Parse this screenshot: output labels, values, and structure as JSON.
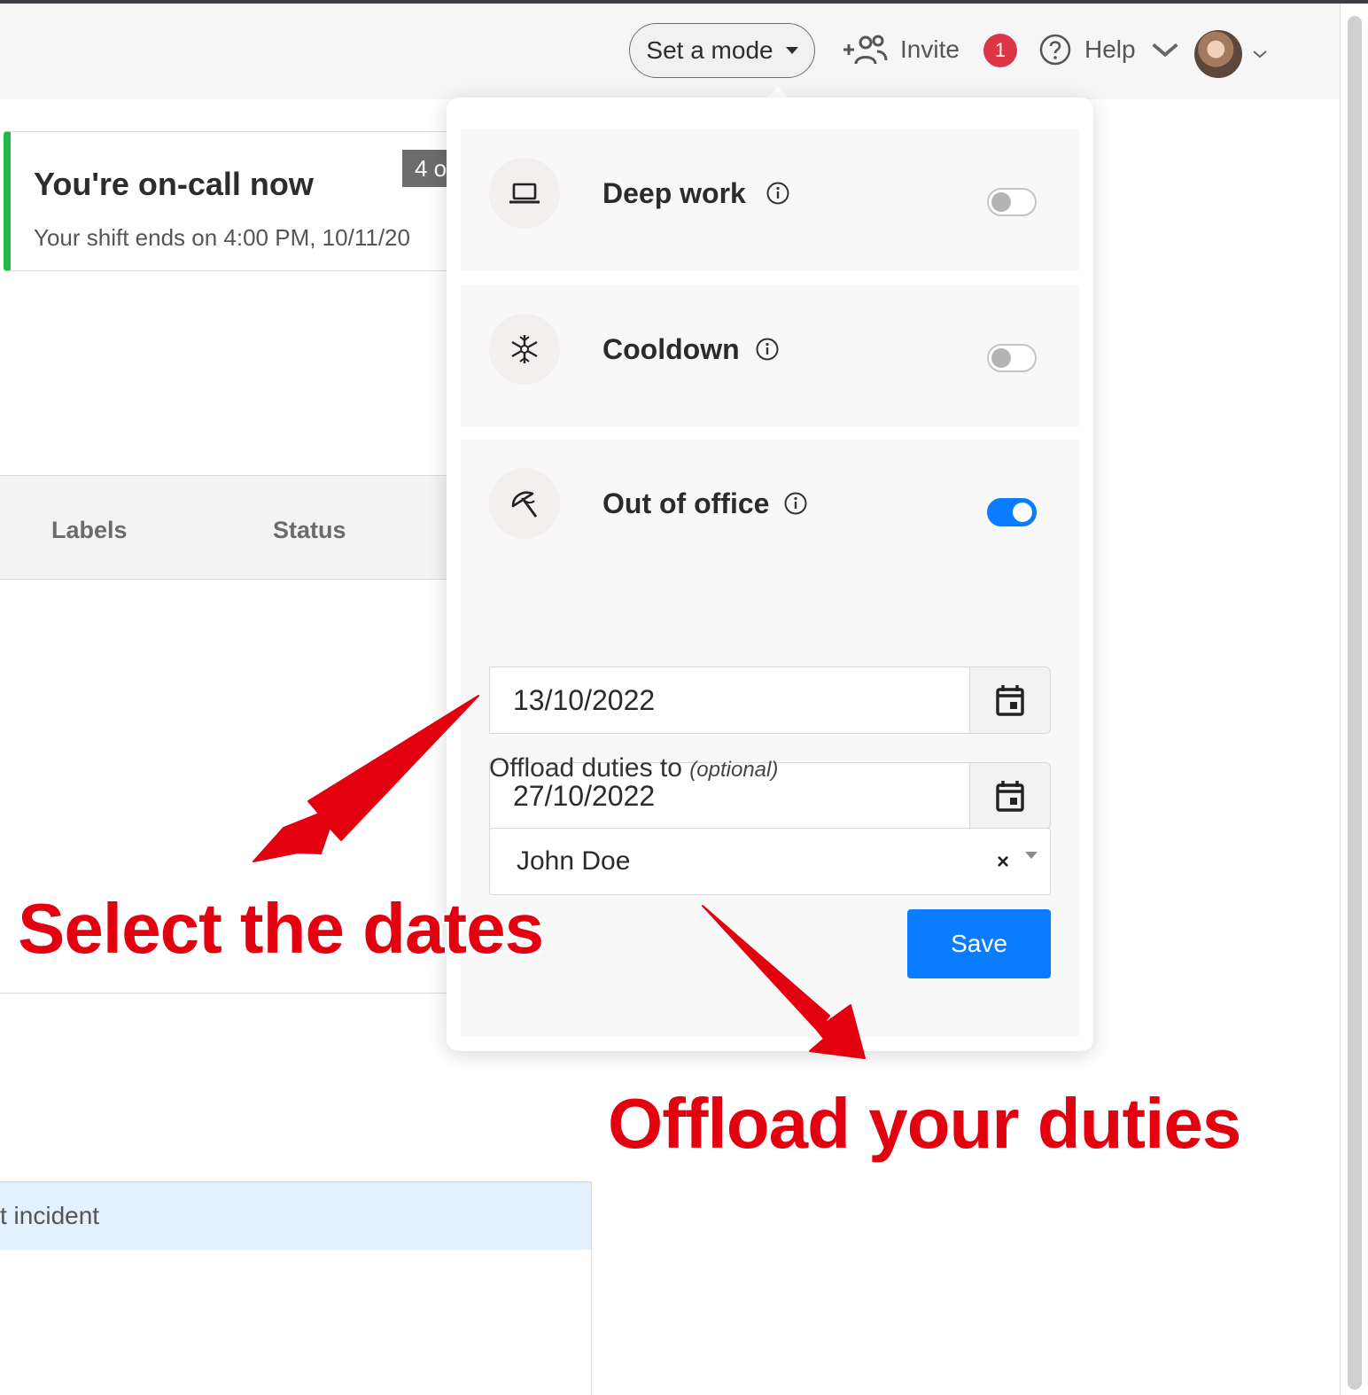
{
  "header": {
    "mode_button_label": "Set a mode",
    "invite_label": "Invite",
    "notification_count": "1",
    "help_label": "Help"
  },
  "oncall": {
    "title": "You're on-call now",
    "subtitle": "Your shift ends on 4:00 PM, 10/11/20",
    "badge": "4 o"
  },
  "table": {
    "columns": [
      "Labels",
      "Status"
    ]
  },
  "incident_bar": {
    "text": "t incident"
  },
  "modes": {
    "items": [
      {
        "label": "Deep work",
        "icon": "laptop-icon",
        "enabled": false
      },
      {
        "label": "Cooldown",
        "icon": "snowflake-icon",
        "enabled": false
      },
      {
        "label": "Out of office",
        "icon": "umbrella-icon",
        "enabled": true
      }
    ],
    "out_of_office": {
      "start_date": "13/10/2022",
      "end_date": "27/10/2022",
      "offload_label": "Offload duties to",
      "offload_optional": "(optional)",
      "offload_value": "John Doe",
      "clear_symbol": "×",
      "save_label": "Save"
    }
  },
  "annotations": {
    "select_dates": "Select the dates",
    "offload": "Offload your duties",
    "color": "#e3000f"
  },
  "colors": {
    "accent": "#0a7cff",
    "oncall_bar": "#27b64a",
    "notification": "#dc3545"
  }
}
